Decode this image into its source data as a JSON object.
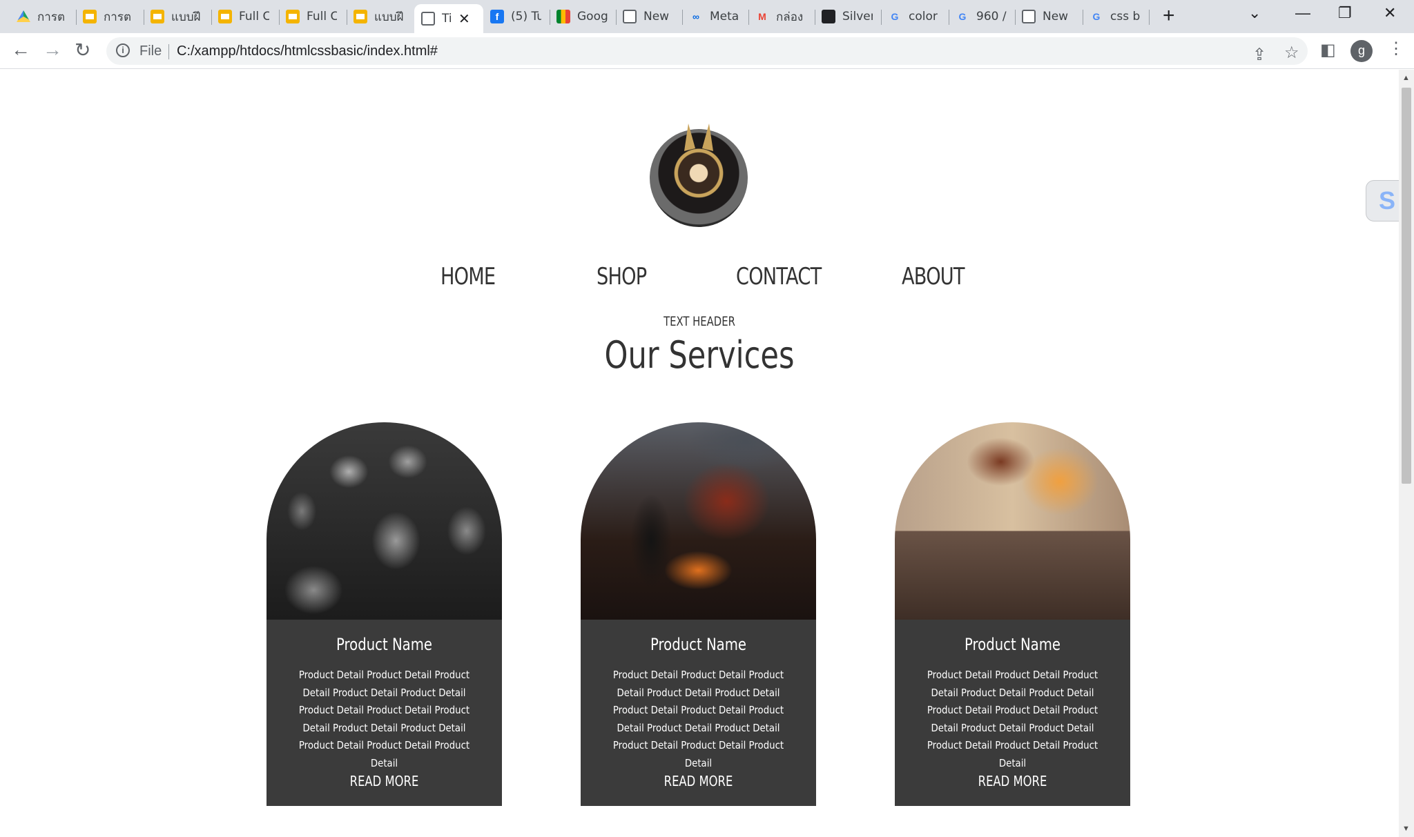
{
  "browser": {
    "tabs": [
      {
        "title": "การต",
        "icon": "drive-icon"
      },
      {
        "title": "การต",
        "icon": "slides-icon"
      },
      {
        "title": "แบบฝึ",
        "icon": "slides-icon"
      },
      {
        "title": "Full C",
        "icon": "slides-icon"
      },
      {
        "title": "Full C",
        "icon": "slides-icon"
      },
      {
        "title": "แบบฝึ",
        "icon": "slides-icon"
      },
      {
        "title": "Ti",
        "icon": "globe-icon",
        "active": true
      },
      {
        "title": "(5) Tu",
        "icon": "facebook-icon"
      },
      {
        "title": "Goog",
        "icon": "google-meet-icon"
      },
      {
        "title": "New",
        "icon": "chrome-icon"
      },
      {
        "title": "Meta",
        "icon": "meta-icon"
      },
      {
        "title": "กล่อง",
        "icon": "gmail-icon"
      },
      {
        "title": "Silver",
        "icon": "silver-icon"
      },
      {
        "title": "color",
        "icon": "google-icon"
      },
      {
        "title": "960 /",
        "icon": "google-icon"
      },
      {
        "title": "New",
        "icon": "chrome-icon"
      },
      {
        "title": "css b",
        "icon": "google-icon"
      }
    ],
    "omnibox": {
      "scheme": "File",
      "url": "C:/xampp/htdocs/htmlcssbasic/index.html#"
    },
    "profile_initial": "g"
  },
  "page": {
    "nav": [
      "HOME",
      "SHOP",
      "CONTACT",
      "ABOUT"
    ],
    "subheader": "TEXT HEADER",
    "title": "Our Services",
    "cards": [
      {
        "name": "Product Name",
        "detail": "Product Detail Product Detail Product Detail Product Detail Product Detail Product Detail Product Detail Product Detail Product Detail Product Detail Product Detail Product Detail Product Detail",
        "more": "READ MORE",
        "image": "knights-armor-image"
      },
      {
        "name": "Product Name",
        "detail": "Product Detail Product Detail Product Detail Product Detail Product Detail Product Detail Product Detail Product Detail Product Detail Product Detail Product Detail Product Detail Product Detail",
        "more": "READ MORE",
        "image": "warrior-vs-dragon-image"
      },
      {
        "name": "Product Name",
        "detail": "Product Detail Product Detail Product Detail Product Detail Product Detail Product Detail Product Detail Product Detail Product Detail Product Detail Product Detail Product Detail Product Detail",
        "more": "READ MORE",
        "image": "dragon-castle-image"
      }
    ]
  },
  "colors": {
    "card_body": "#3b3b3b",
    "text_dark": "#333333",
    "tabbar": "#dee1e6"
  }
}
